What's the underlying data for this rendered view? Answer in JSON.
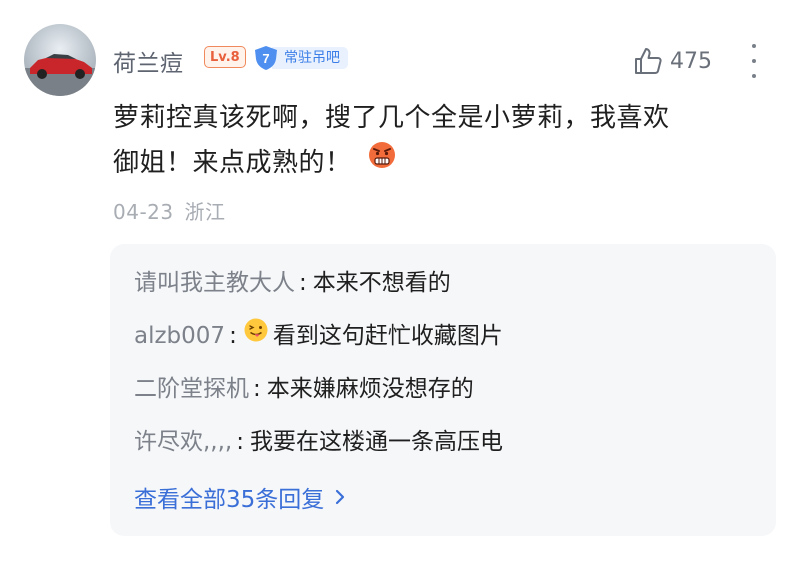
{
  "comment": {
    "username": "荷兰痘",
    "level_badge": "Lv.8",
    "member_level": "7",
    "member_label": "常驻吊吧",
    "like_count": "475",
    "text_line1": "萝莉控真该死啊，搜了几个全是小萝莉，我喜欢",
    "text_line2": "御姐！来点成熟的！",
    "date": "04-23",
    "location": "浙江"
  },
  "replies": [
    {
      "author": "请叫我主教大人",
      "text": "本来不想看的"
    },
    {
      "author": "alzb007",
      "text": "看到这句赶忙收藏图片"
    },
    {
      "author": "二阶堂探机",
      "text": "本来嫌麻烦没想存的"
    },
    {
      "author": "许尽欢,,,,",
      "text": "我要在这楼通一条高压电"
    }
  ],
  "view_all_label": "查看全部35条回复",
  "icons": {
    "like": "thumbs-up-icon",
    "more": "more-vertical-icon",
    "member": "shield-icon",
    "chevron": "chevron-right-icon"
  },
  "colors": {
    "link_blue": "#3b6fd8",
    "level_orange": "#e8603c",
    "member_blue": "#3b7ee8",
    "reply_author_gray": "#7c818a"
  }
}
